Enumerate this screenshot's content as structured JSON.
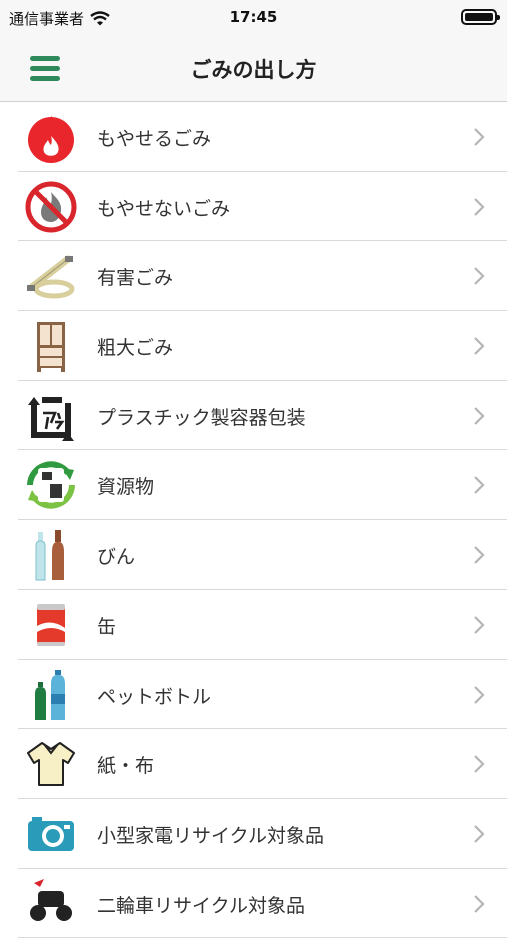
{
  "status": {
    "carrier": "通信事業者",
    "time": "17:45"
  },
  "nav": {
    "title": "ごみの出し方"
  },
  "items": [
    {
      "label": "もやせるごみ",
      "icon": "flame-icon"
    },
    {
      "label": "もやせないごみ",
      "icon": "no-burn-icon"
    },
    {
      "label": "有害ごみ",
      "icon": "fluorescent-tube-icon"
    },
    {
      "label": "粗大ごみ",
      "icon": "cabinet-icon"
    },
    {
      "label": "プラスチック製容器包装",
      "icon": "plastic-mark-icon"
    },
    {
      "label": "資源物",
      "icon": "recycle-resource-icon"
    },
    {
      "label": "びん",
      "icon": "bottle-icon"
    },
    {
      "label": "缶",
      "icon": "can-icon"
    },
    {
      "label": "ペットボトル",
      "icon": "pet-bottle-icon"
    },
    {
      "label": "紙・布",
      "icon": "shirt-icon"
    },
    {
      "label": "小型家電リサイクル対象品",
      "icon": "camera-icon"
    },
    {
      "label": "二輪車リサイクル対象品",
      "icon": "motorcycle-icon"
    }
  ],
  "colors": {
    "accent": "#2f8a5b",
    "divider": "#d9d9d9",
    "chevron": "#b5b5b5"
  }
}
